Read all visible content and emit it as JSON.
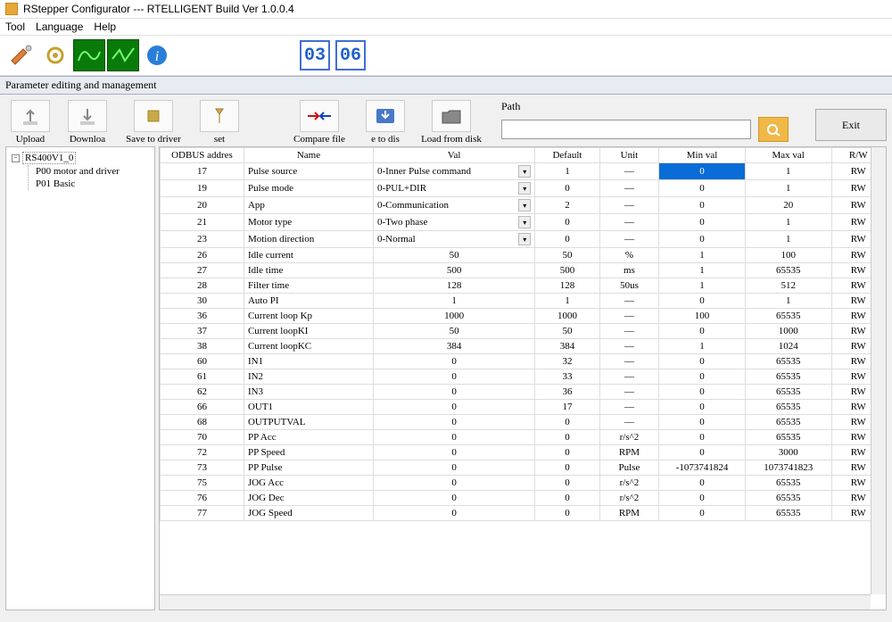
{
  "window": {
    "title": "RStepper Configurator --- RTELLIGENT  Build Ver 1.0.0.4"
  },
  "menu": {
    "tool": "Tool",
    "language": "Language",
    "help": "Help"
  },
  "digits": {
    "a": "03",
    "b": "06"
  },
  "section": {
    "title": "Parameter editing and management"
  },
  "actions": {
    "upload": "Upload",
    "download": "Downloa",
    "save_to_driver": "Save to driver",
    "set": "set",
    "compare_file": "Compare file",
    "to_disk": "e to dis",
    "load_from_disk": "Load from disk",
    "path_label": "Path",
    "exit": "Exit"
  },
  "tree": {
    "root": "RS400V1_0",
    "children": [
      "P00 motor and driver",
      "P01 Basic"
    ]
  },
  "columns": {
    "addr": "ODBUS addres",
    "name": "Name",
    "val": "Val",
    "default": "Default",
    "unit": "Unit",
    "minval": "Min val",
    "maxval": "Max val",
    "rw": "R/W"
  },
  "rows": [
    {
      "addr": "17",
      "name": "Pulse source",
      "val": "0-Inner Pulse command",
      "dropdown": true,
      "default": "1",
      "unit": "—",
      "min": "0",
      "min_hl": true,
      "max": "1",
      "rw": "RW"
    },
    {
      "addr": "19",
      "name": "Pulse mode",
      "val": "0-PUL+DIR",
      "dropdown": true,
      "default": "0",
      "unit": "—",
      "min": "0",
      "max": "1",
      "rw": "RW"
    },
    {
      "addr": "20",
      "name": "App",
      "val": "0-Communication",
      "dropdown": true,
      "default": "2",
      "unit": "—",
      "min": "0",
      "max": "20",
      "rw": "RW"
    },
    {
      "addr": "21",
      "name": "Motor type",
      "val": "0-Two phase",
      "dropdown": true,
      "default": "0",
      "unit": "—",
      "min": "0",
      "max": "1",
      "rw": "RW"
    },
    {
      "addr": "23",
      "name": "Motion direction",
      "val": "0-Normal",
      "dropdown": true,
      "default": "0",
      "unit": "—",
      "min": "0",
      "max": "1",
      "rw": "RW"
    },
    {
      "addr": "26",
      "name": "Idle current",
      "val": "50",
      "default": "50",
      "unit": "%",
      "min": "1",
      "max": "100",
      "rw": "RW"
    },
    {
      "addr": "27",
      "name": "Idle time",
      "val": "500",
      "default": "500",
      "unit": "ms",
      "min": "1",
      "max": "65535",
      "rw": "RW"
    },
    {
      "addr": "28",
      "name": "Filter time",
      "val": "128",
      "default": "128",
      "unit": "50us",
      "min": "1",
      "max": "512",
      "rw": "RW"
    },
    {
      "addr": "30",
      "name": "Auto PI",
      "val": "1",
      "default": "1",
      "unit": "—",
      "min": "0",
      "max": "1",
      "rw": "RW"
    },
    {
      "addr": "36",
      "name": "Current loop Kp",
      "val": "1000",
      "default": "1000",
      "unit": "—",
      "min": "100",
      "max": "65535",
      "rw": "RW"
    },
    {
      "addr": "37",
      "name": "Current loopKI",
      "val": "50",
      "default": "50",
      "unit": "—",
      "min": "0",
      "max": "1000",
      "rw": "RW"
    },
    {
      "addr": "38",
      "name": "Current loopKC",
      "val": "384",
      "default": "384",
      "unit": "—",
      "min": "1",
      "max": "1024",
      "rw": "RW"
    },
    {
      "addr": "60",
      "name": "IN1",
      "val": "0",
      "default": "32",
      "unit": "—",
      "min": "0",
      "max": "65535",
      "rw": "RW"
    },
    {
      "addr": "61",
      "name": "IN2",
      "val": "0",
      "default": "33",
      "unit": "—",
      "min": "0",
      "max": "65535",
      "rw": "RW"
    },
    {
      "addr": "62",
      "name": "IN3",
      "val": "0",
      "default": "36",
      "unit": "—",
      "min": "0",
      "max": "65535",
      "rw": "RW"
    },
    {
      "addr": "66",
      "name": "OUT1",
      "val": "0",
      "default": "17",
      "unit": "—",
      "min": "0",
      "max": "65535",
      "rw": "RW"
    },
    {
      "addr": "68",
      "name": "OUTPUTVAL",
      "val": "0",
      "default": "0",
      "unit": "—",
      "min": "0",
      "max": "65535",
      "rw": "RW"
    },
    {
      "addr": "70",
      "name": "PP Acc",
      "val": "0",
      "default": "0",
      "unit": "r/s^2",
      "min": "0",
      "max": "65535",
      "rw": "RW"
    },
    {
      "addr": "72",
      "name": "PP Speed",
      "val": "0",
      "default": "0",
      "unit": "RPM",
      "min": "0",
      "max": "3000",
      "rw": "RW"
    },
    {
      "addr": "73",
      "name": "PP Pulse",
      "val": "0",
      "default": "0",
      "unit": "Pulse",
      "min": "-1073741824",
      "max": "1073741823",
      "rw": "RW"
    },
    {
      "addr": "75",
      "name": "JOG Acc",
      "val": "0",
      "default": "0",
      "unit": "r/s^2",
      "min": "0",
      "max": "65535",
      "rw": "RW"
    },
    {
      "addr": "76",
      "name": "JOG Dec",
      "val": "0",
      "default": "0",
      "unit": "r/s^2",
      "min": "0",
      "max": "65535",
      "rw": "RW"
    },
    {
      "addr": "77",
      "name": "JOG Speed",
      "val": "0",
      "default": "0",
      "unit": "RPM",
      "min": "0",
      "max": "65535",
      "rw": "RW"
    }
  ]
}
